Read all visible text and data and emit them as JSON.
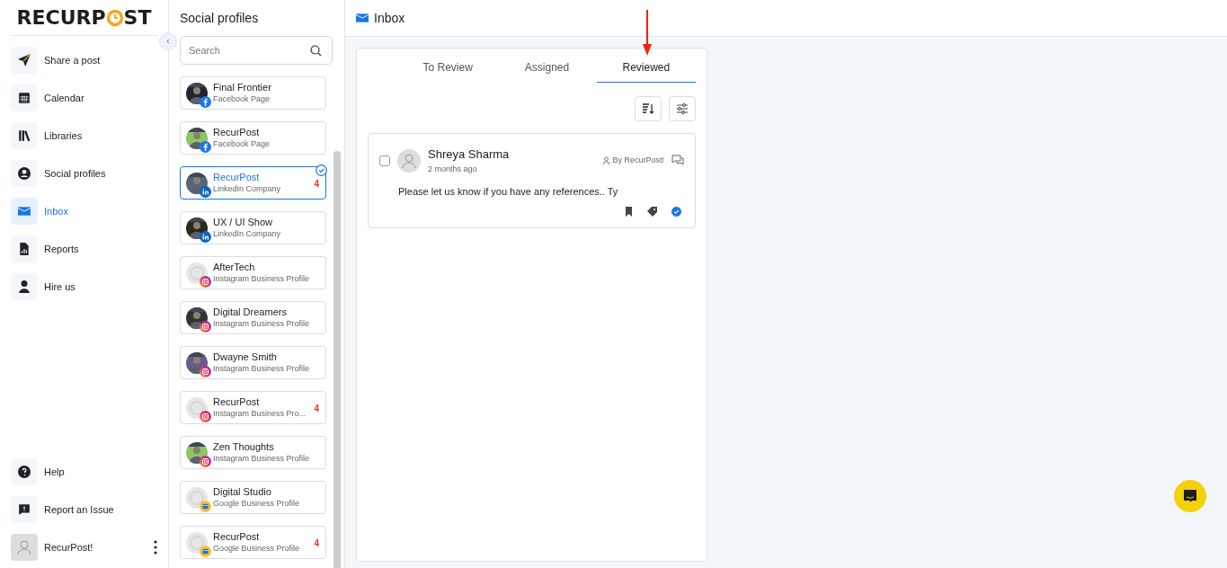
{
  "logo": {
    "before": "RECURP",
    "after": "ST"
  },
  "nav": [
    {
      "label": "Share a post",
      "selected": false
    },
    {
      "label": "Calendar",
      "selected": false
    },
    {
      "label": "Libraries",
      "selected": false
    },
    {
      "label": "Social profiles",
      "selected": false
    },
    {
      "label": "Inbox",
      "selected": true
    },
    {
      "label": "Reports",
      "selected": false
    },
    {
      "label": "Hire us",
      "selected": false
    }
  ],
  "nav_bottom": [
    {
      "label": "Help"
    },
    {
      "label": "Report an Issue"
    }
  ],
  "user": {
    "name": "RecurPost!"
  },
  "profiles_panel": {
    "title": "Social profiles",
    "search": {
      "placeholder": "Search"
    },
    "profiles": [
      {
        "name": "Final Frontier",
        "type": "Facebook Page",
        "kind": "facebook",
        "selected": false
      },
      {
        "name": "RecurPost",
        "type": "Facebook Page",
        "kind": "facebook",
        "selected": false
      },
      {
        "name": "RecurPost",
        "type": "LinkedIn Company",
        "kind": "linkedin",
        "selected": true,
        "count": "4"
      },
      {
        "name": "UX / UI Show",
        "type": "LinkedIn Company",
        "kind": "linkedin",
        "selected": false
      },
      {
        "name": "AfterTech",
        "type": "Instagram Business Profile",
        "kind": "instagram",
        "selected": false
      },
      {
        "name": "Digital Dreamers",
        "type": "Instagram Business Profile",
        "kind": "instagram",
        "selected": false
      },
      {
        "name": "Dwayne Smith",
        "type": "Instagram Business Profile",
        "kind": "instagram",
        "selected": false
      },
      {
        "name": "RecurPost",
        "type": "Instagram Business Pro...",
        "kind": "instagram",
        "selected": false,
        "count": "4"
      },
      {
        "name": "Zen Thoughts",
        "type": "Instagram Business Profile",
        "kind": "instagram",
        "selected": false
      },
      {
        "name": "Digital Studio",
        "type": "Google Business Profile",
        "kind": "google",
        "selected": false
      },
      {
        "name": "RecurPost",
        "type": "Google Business Profile",
        "kind": "google",
        "selected": false,
        "count": "4"
      }
    ]
  },
  "header": {
    "title": "Inbox"
  },
  "tabs": [
    {
      "label": "To Review",
      "selected": false
    },
    {
      "label": "Assigned",
      "selected": false
    },
    {
      "label": "Reviewed",
      "selected": true
    }
  ],
  "messages": [
    {
      "author": "Shreya Sharma",
      "time": "2 months ago",
      "by": "By RecurPost!",
      "text": "Please let us know if you have any references.. Ty",
      "checked": false,
      "reviewed": true
    }
  ]
}
